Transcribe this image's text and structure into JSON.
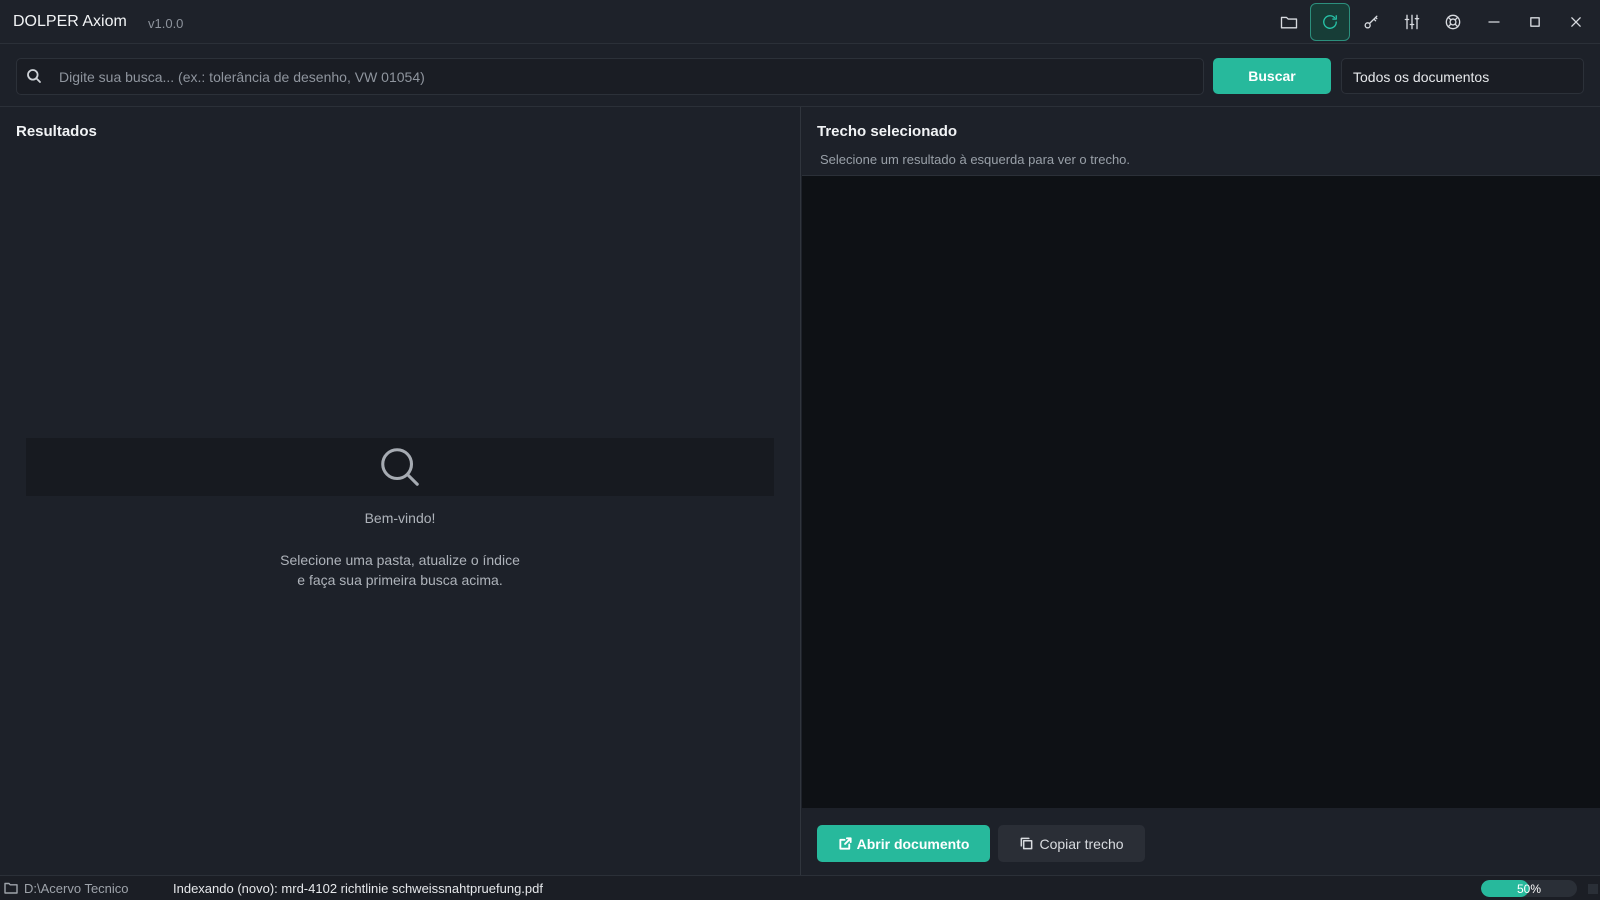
{
  "app": {
    "title": "DOLPER Axiom",
    "version": "v1.0.0"
  },
  "toolbar": {
    "icons": [
      "folder-icon",
      "refresh-icon",
      "key-icon",
      "sliders-icon",
      "lifebuoy-icon",
      "minimize-icon",
      "maximize-icon",
      "close-icon"
    ],
    "active": "refresh-icon",
    "accent_color": "#27b99c"
  },
  "search": {
    "placeholder": "Digite sua busca... (ex.: tolerância de desenho, VW 01054)",
    "value": "",
    "button_label": "Buscar",
    "filter_selected": "Todos os documentos"
  },
  "results": {
    "title": "Resultados",
    "empty_icon": "search-icon",
    "welcome": "Bem-vindo!",
    "hint_line1": "Selecione uma pasta, atualize o índice",
    "hint_line2": "e faça sua primeira busca acima."
  },
  "snippet": {
    "title": "Trecho selecionado",
    "subtitle": "Selecione um resultado à esquerda para ver o trecho.",
    "open_label": "Abrir documento",
    "copy_label": "Copiar trecho"
  },
  "status": {
    "path": "D:\\Acervo Tecnico",
    "indexing": "Indexando (novo): mrd-4102 richtlinie schweissnahtpruefung.pdf",
    "progress_percent": 50,
    "progress_label": "50%"
  }
}
